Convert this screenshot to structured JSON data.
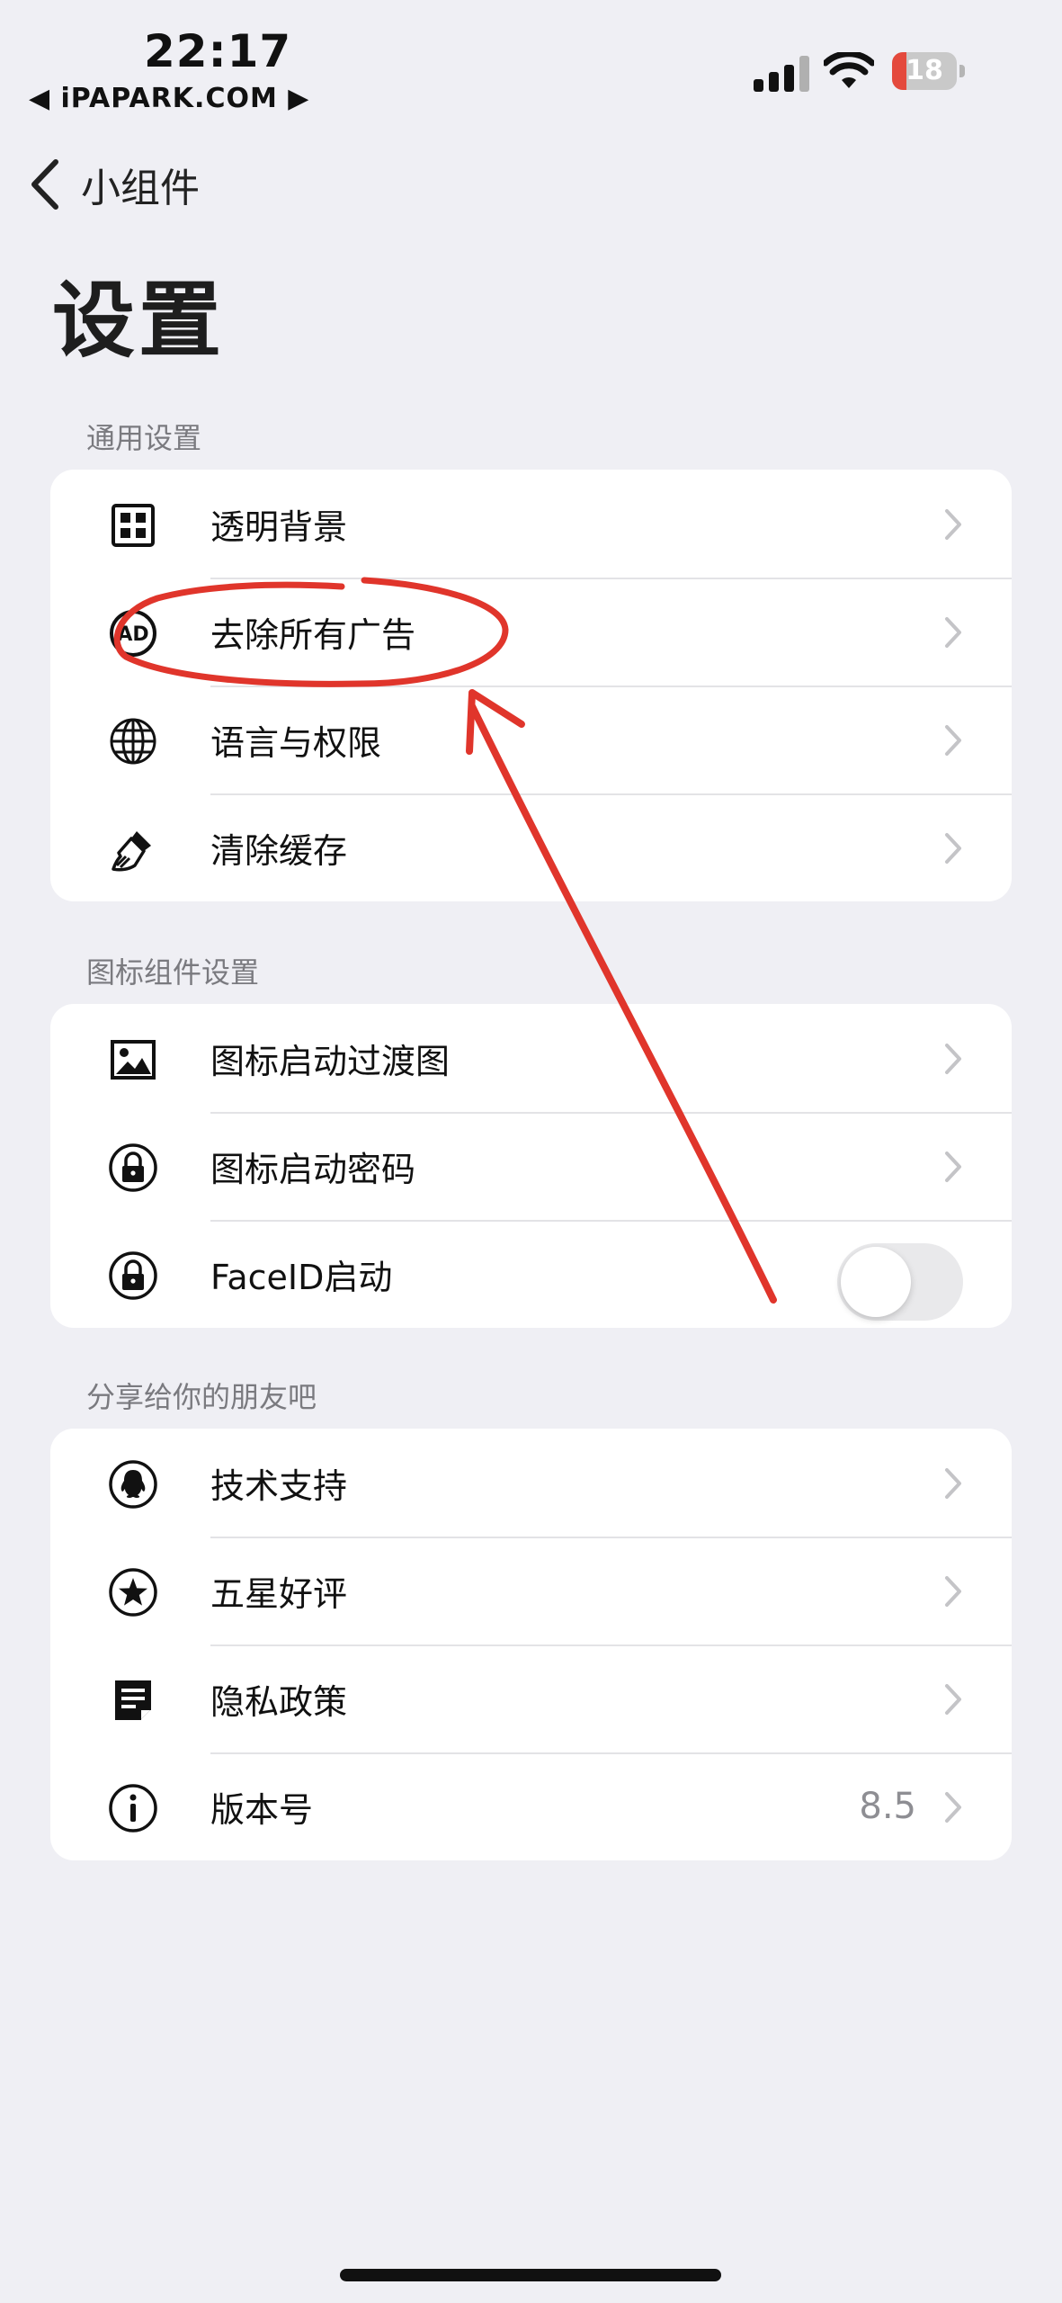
{
  "status_bar": {
    "time": "22:17",
    "carrier": "◀ iPAPARK.COM ▶",
    "battery": "18",
    "battery_color": "#e4493c"
  },
  "nav": {
    "back_label": "小组件"
  },
  "title": "设置",
  "sections": [
    {
      "header": "通用设置",
      "items": [
        {
          "label": "透明背景",
          "icon": "grid-icon"
        },
        {
          "label": "去除所有广告",
          "icon": "ad-icon"
        },
        {
          "label": "语言与权限",
          "icon": "globe-icon"
        },
        {
          "label": "清除缓存",
          "icon": "brush-icon"
        }
      ]
    },
    {
      "header": "图标组件设置",
      "items": [
        {
          "label": "图标启动过渡图",
          "icon": "image-icon"
        },
        {
          "label": "图标启动密码",
          "icon": "lock-icon"
        },
        {
          "label": "FaceID启动",
          "icon": "lock-icon",
          "toggle": false
        }
      ]
    },
    {
      "header": "分享给你的朋友吧",
      "items": [
        {
          "label": "技术支持",
          "icon": "qq-icon"
        },
        {
          "label": "五星好评",
          "icon": "star-icon"
        },
        {
          "label": "隐私政策",
          "icon": "document-icon"
        },
        {
          "label": "版本号",
          "icon": "info-icon",
          "value": "8.5"
        }
      ]
    }
  ],
  "annotation_color": "#e0352b"
}
